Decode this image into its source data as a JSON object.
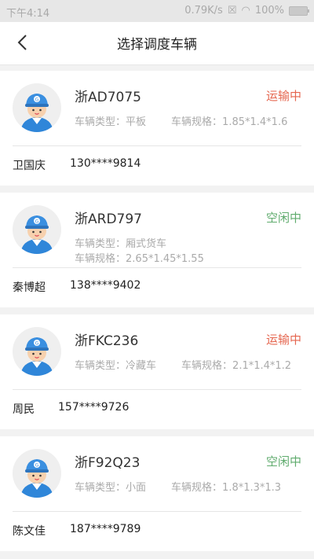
{
  "statusbar": {
    "time": "下午4:14",
    "network_speed": "0.79K/s",
    "battery": "100%"
  },
  "header": {
    "title": "选择调度车辆"
  },
  "vehicles": [
    {
      "plate": "浙AD7075",
      "status": "运输中",
      "status_type": "busy",
      "type_label": "车辆类型：",
      "type": "平板",
      "spec_label": "车辆规格：",
      "spec": "1.85*1.4*1.6",
      "driver": "卫国庆",
      "phone": "130****9814"
    },
    {
      "plate": "浙ARD797",
      "status": "空闲中",
      "status_type": "idle",
      "type_label": "车辆类型：",
      "type": "厢式货车",
      "spec_label": "车辆规格：",
      "spec": "2.65*1.45*1.55",
      "driver": "秦博超",
      "phone": "138****9402"
    },
    {
      "plate": "浙FKC236",
      "status": "运输中",
      "status_type": "busy",
      "type_label": "车辆类型：",
      "type": "冷藏车",
      "spec_label": "车辆规格：",
      "spec": "2.1*1.4*1.2",
      "driver": "周民",
      "phone": "157****9726"
    },
    {
      "plate": "浙F92Q23",
      "status": "空闲中",
      "status_type": "idle",
      "type_label": "车辆类型：",
      "type": "小面",
      "spec_label": "车辆规格：",
      "spec": "1.8*1.3*1.3",
      "driver": "陈文佳",
      "phone": "187****9789"
    }
  ],
  "colors": {
    "busy": "#e5664f",
    "idle": "#5fab6d"
  }
}
